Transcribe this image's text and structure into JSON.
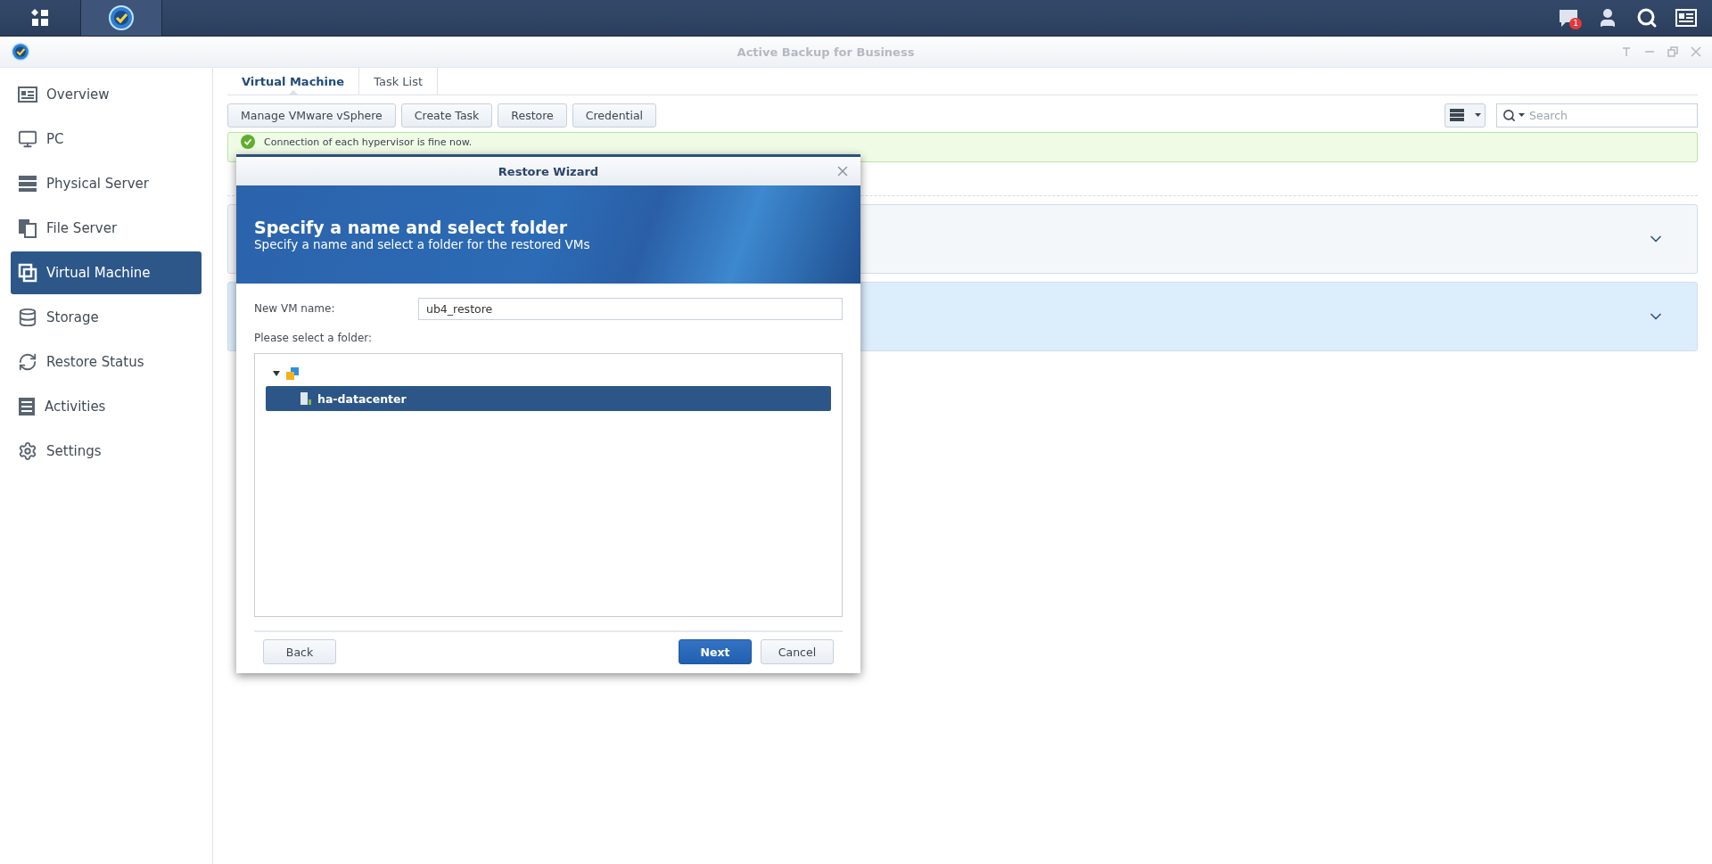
{
  "taskbar": {
    "notification_count": "1"
  },
  "window": {
    "title": "Active Backup for Business"
  },
  "sidebar": {
    "items": [
      {
        "label": "Overview",
        "selected": false
      },
      {
        "label": "PC",
        "selected": false
      },
      {
        "label": "Physical Server",
        "selected": false
      },
      {
        "label": "File Server",
        "selected": false
      },
      {
        "label": "Virtual Machine",
        "selected": true
      },
      {
        "label": "Storage",
        "selected": false
      },
      {
        "label": "Restore Status",
        "selected": false
      },
      {
        "label": "Activities",
        "selected": false
      },
      {
        "label": "Settings",
        "selected": false
      }
    ]
  },
  "tabs": [
    {
      "label": "Virtual Machine",
      "selected": true
    },
    {
      "label": "Task List",
      "selected": false
    }
  ],
  "toolbar": {
    "buttons": [
      "Manage VMware vSphere",
      "Create Task",
      "Restore",
      "Credential"
    ],
    "search": {
      "placeholder": "Search"
    }
  },
  "status_banner": {
    "message": "Connection of each hypervisor is fine now."
  },
  "cards": [
    {
      "expanded": false,
      "selected": false
    },
    {
      "expanded": false,
      "selected": true
    }
  ],
  "dialog": {
    "title": "Restore Wizard",
    "heading": "Specify a name and select folder",
    "subheading": "Specify a name and select a folder for the restored VMs",
    "name_label": "New VM name:",
    "name_value": "ub4_restore",
    "folder_label": "Please select a folder:",
    "tree": [
      {
        "kind": "host",
        "expanded": true,
        "selected": false,
        "children": [
          {
            "kind": "datacenter",
            "label": "ha-datacenter",
            "selected": true
          }
        ]
      }
    ],
    "left_buttons": [
      {
        "label": "Back",
        "primary": false
      }
    ],
    "right_buttons": [
      {
        "label": "Next",
        "primary": true
      },
      {
        "label": "Cancel",
        "primary": false
      }
    ]
  }
}
